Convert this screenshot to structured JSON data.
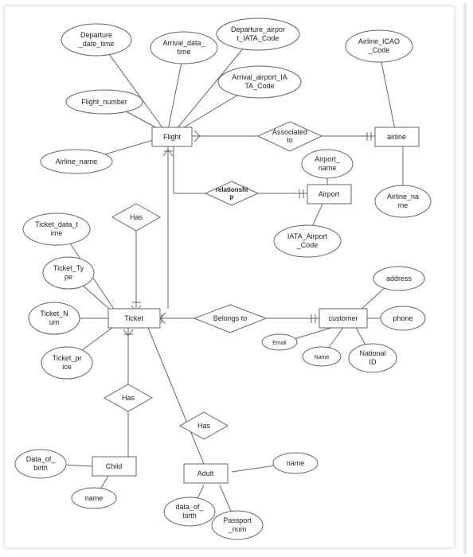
{
  "entities": {
    "flight": "Flight",
    "airline": "airline",
    "airport": "Airport",
    "ticket": "Ticket",
    "customer": "customer",
    "child": "Child",
    "adult": "Adult"
  },
  "relationships": {
    "associated_to": "Associated\nto",
    "relationship": "relationshi\np",
    "has_flight_ticket": "Has",
    "belongs_to": "Belongs to",
    "has_ticket_child": "Has",
    "has_ticket_adult": "Has"
  },
  "attributes": {
    "departure_date_time": "Departure\n_date_time",
    "arrival_data_time": "Arrival_data_\ntime",
    "departure_airport_iata": "Departure_airpor\nt_IATA_Code",
    "arrival_airport_iata": "Arrival_airport_IA\nTA_Code",
    "flight_number": "Flight_number",
    "airline_name_flight": "Airline_name",
    "airline_icao_code": "Airline_ICAO\n_Code",
    "airline_name": "Airline_na\nme",
    "airport_name": "Airport_\nname",
    "iata_airport_code": "IATA_Airport\n_Code",
    "ticket_data_time": "Ticket_data_t\nime",
    "ticket_type": "Ticket_Ty\npe",
    "ticket_num": "Ticket_N\num",
    "ticket_price": "Ticket_pr\nice",
    "address": "address",
    "phone": "phone",
    "email": "Email",
    "name_customer": "Name",
    "national_id": "National\nID",
    "child_dob": "Data_of_\nbirth",
    "child_name": "name",
    "adult_name": "name",
    "adult_dob": "data_of_\nbirth",
    "passport_num": "Passport\n_num"
  }
}
